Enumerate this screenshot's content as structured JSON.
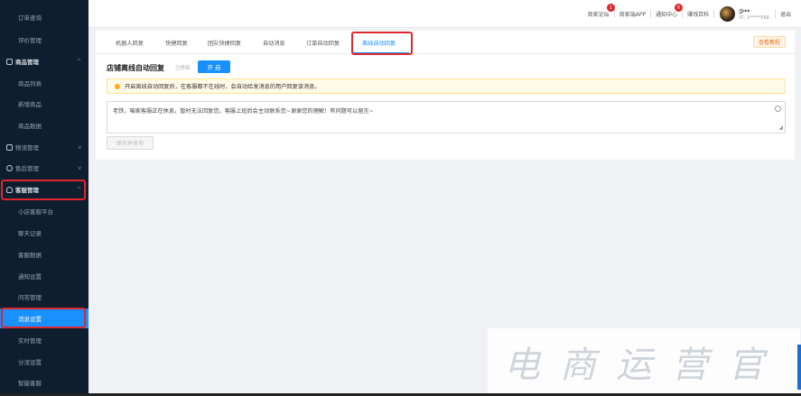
{
  "sidebar": {
    "items": [
      {
        "label": "订单查询",
        "type": "sub"
      },
      {
        "label": "评价管理",
        "type": "sub"
      },
      {
        "label": "商品管理",
        "type": "group",
        "chev": "^"
      },
      {
        "label": "商品列表",
        "type": "sub"
      },
      {
        "label": "新增商品",
        "type": "sub"
      },
      {
        "label": "商品数据",
        "type": "sub"
      },
      {
        "label": "物流管理",
        "type": "group",
        "chev": "v"
      },
      {
        "label": "售后管理",
        "type": "group",
        "chev": "v"
      },
      {
        "label": "客服管理",
        "type": "group",
        "chev": "^"
      },
      {
        "label": "小店客服平台",
        "type": "sub"
      },
      {
        "label": "聊天记录",
        "type": "sub"
      },
      {
        "label": "客服数据",
        "type": "sub"
      },
      {
        "label": "通知设置",
        "type": "sub"
      },
      {
        "label": "问答管理",
        "type": "sub"
      },
      {
        "label": "消息设置",
        "type": "active"
      },
      {
        "label": "实时管理",
        "type": "sub"
      },
      {
        "label": "分流设置",
        "type": "sub"
      },
      {
        "label": "智能客服",
        "type": "sub"
      }
    ]
  },
  "header": {
    "links": [
      {
        "label": "商家论坛",
        "badge": "1"
      },
      {
        "label": "商家端APP",
        "badge": ""
      },
      {
        "label": "通知中心",
        "badge": "6"
      },
      {
        "label": "赚钱百科",
        "badge": ""
      }
    ],
    "user_name": "少**",
    "user_id": "ID: 1*****566",
    "logout": "退出"
  },
  "tabs": [
    {
      "label": "机器人回复"
    },
    {
      "label": "快捷回复"
    },
    {
      "label": "团队快捷回复"
    },
    {
      "label": "自动消息"
    },
    {
      "label": "订单自动回复"
    },
    {
      "label": "离线自动回复"
    }
  ],
  "active_tab": "离线自动回复",
  "tutorial_label": "查看教程",
  "section": {
    "title": "店铺离线自动回复",
    "status": "已停用",
    "enable_label": "开 启"
  },
  "notice": "开启离线自动回复后，在客服都不在线时，会自动给发消息的用户回复该消息。",
  "message": "老铁，咱家客服正在休息，暂时无法回复您。客服上班后会主动联系您~谢谢您的理解！有问题可以留言~",
  "save_label": "保存并发布",
  "watermark": "电商运营官",
  "colors": {
    "sidebar_bg": "#0f1e2e",
    "accent": "#1890ff",
    "highlight": "#e0262d",
    "notice_bg": "#fffbe6"
  }
}
